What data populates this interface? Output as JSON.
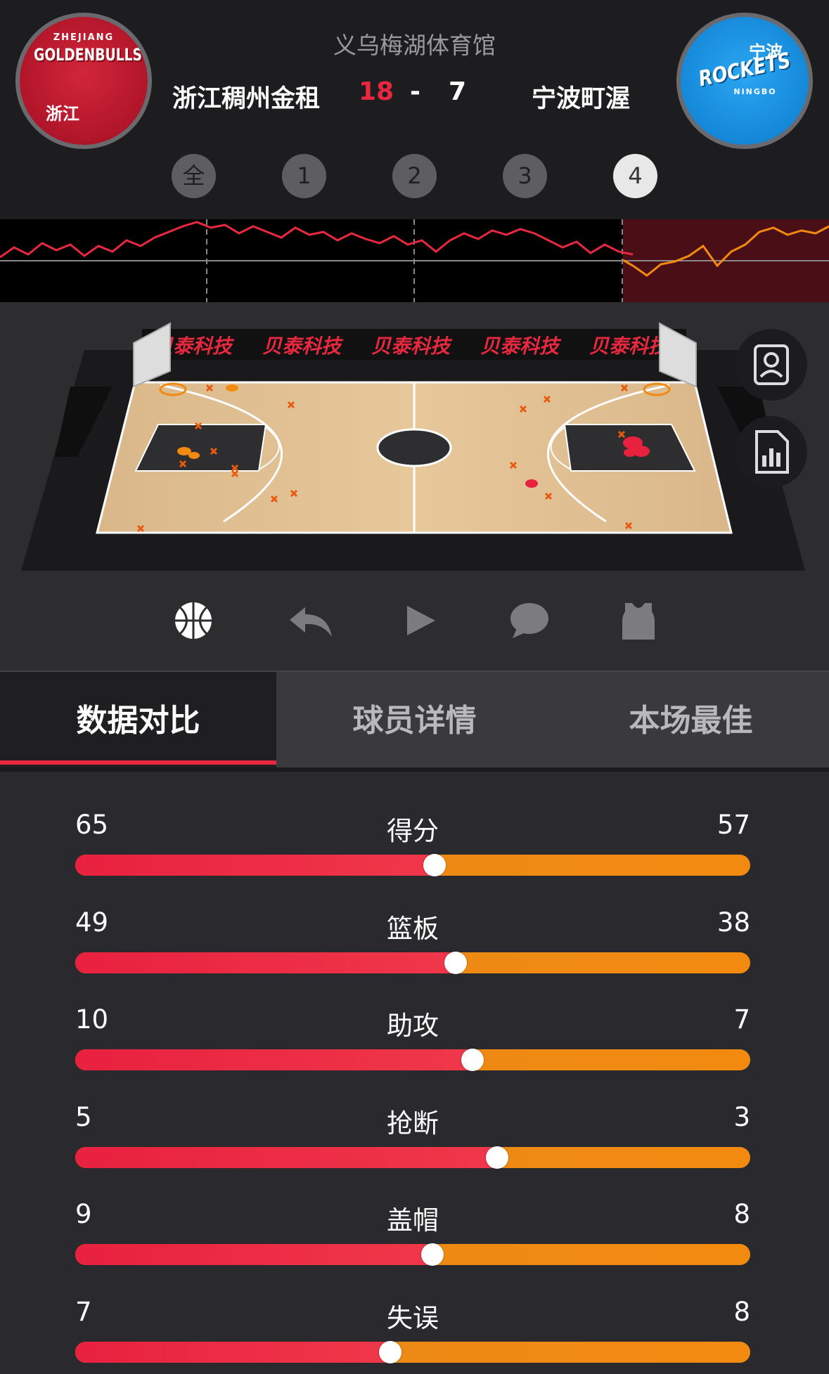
{
  "header": {
    "venue": "义乌梅湖体育馆",
    "home_team": "浙江稠州金租",
    "away_team": "宁波町渥",
    "home_score": "18",
    "score_separator": "-",
    "away_score": "7",
    "home_logo": {
      "line1": "ZHEJIANG",
      "line2": "GOLDENBULLS",
      "line3": "浙江"
    },
    "away_logo": {
      "line1": "宁波",
      "line2": "ROCKETS",
      "line3": "NINGBO"
    }
  },
  "quarters": [
    {
      "label": "全",
      "active": false
    },
    {
      "label": "1",
      "active": false
    },
    {
      "label": "2",
      "active": false
    },
    {
      "label": "3",
      "active": false
    },
    {
      "label": "4",
      "active": true
    }
  ],
  "court": {
    "sponsor_text": "贝泰科技",
    "sponsor_repeat": 5
  },
  "controls": [
    "basketball-icon",
    "reply-icon",
    "play-icon",
    "comment-icon",
    "jersey-icon"
  ],
  "side_buttons": [
    "player-card-icon",
    "stats-chart-icon"
  ],
  "tabs": [
    {
      "label": "数据对比",
      "active": true
    },
    {
      "label": "球员详情",
      "active": false
    },
    {
      "label": "本场最佳",
      "active": false
    }
  ],
  "stats": [
    {
      "label": "得分",
      "home": "65",
      "away": "57"
    },
    {
      "label": "篮板",
      "home": "49",
      "away": "38"
    },
    {
      "label": "助攻",
      "home": "10",
      "away": "7"
    },
    {
      "label": "抢断",
      "home": "5",
      "away": "3"
    },
    {
      "label": "盖帽",
      "home": "9",
      "away": "8"
    },
    {
      "label": "失误",
      "home": "7",
      "away": "8"
    }
  ],
  "colors": {
    "home_accent": "#e8283e",
    "away_accent": "#f28a10",
    "header_bg": "#1d1d20"
  }
}
